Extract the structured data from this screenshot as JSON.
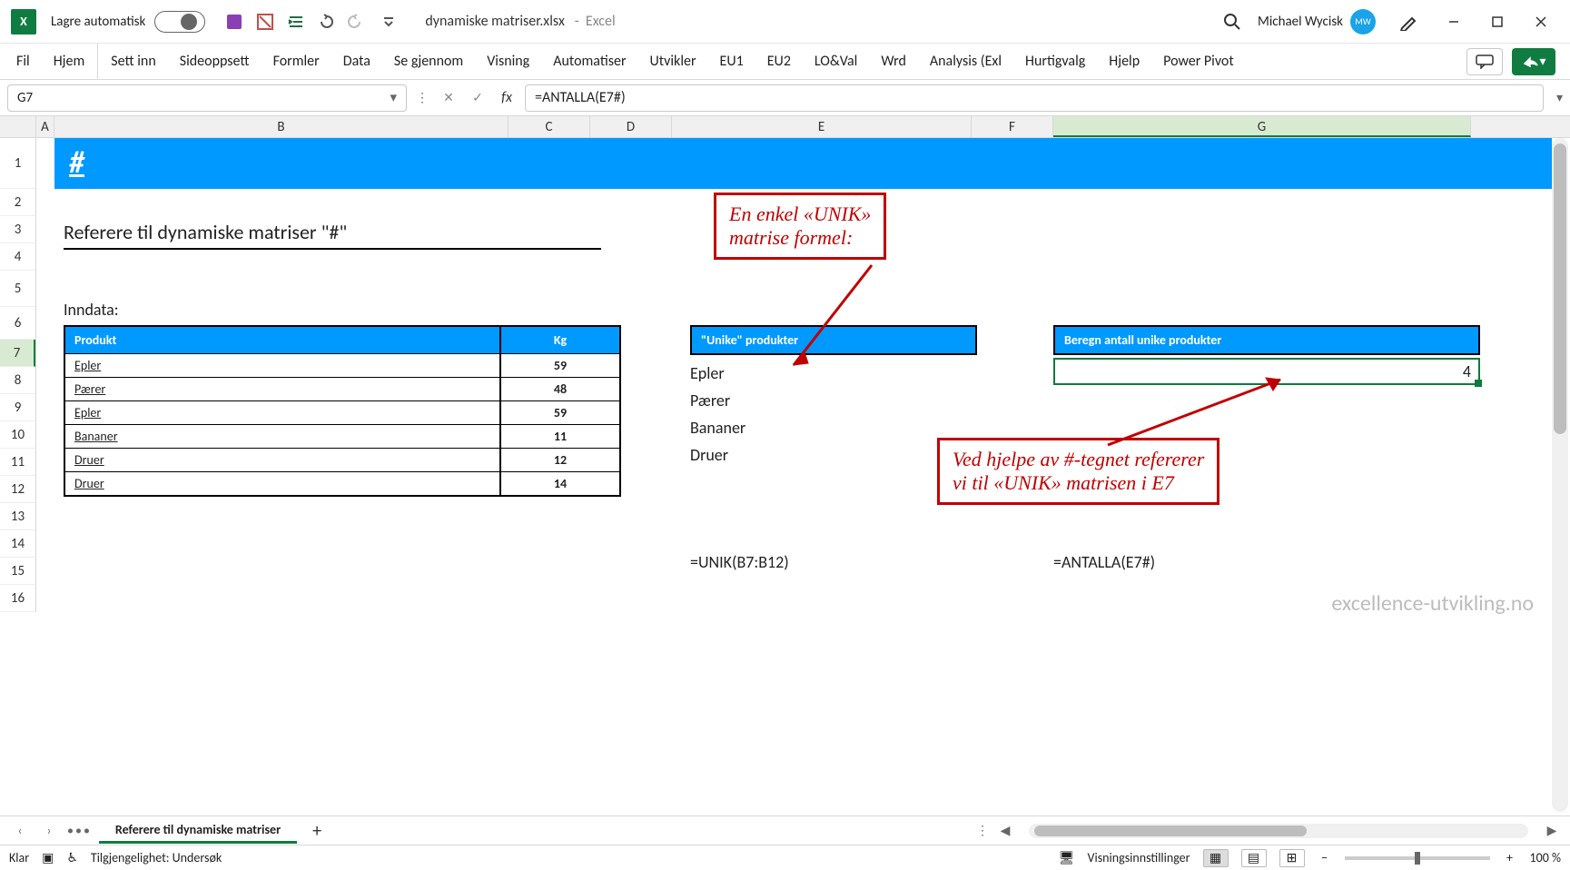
{
  "titlebar": {
    "autosave_label": "Lagre automatisk",
    "filename": "dynamiske matriser.xlsx",
    "appname": "Excel",
    "username": "Michael Wycisk"
  },
  "ribbon": {
    "tabs": [
      "Fil",
      "Hjem",
      "Sett inn",
      "Sideoppsett",
      "Formler",
      "Data",
      "Se gjennom",
      "Visning",
      "Automatiser",
      "Utvikler",
      "EU1",
      "EU2",
      "LO&Val",
      "Wrd",
      "Analysis (Exl",
      "Hurtigvalg",
      "Hjelp",
      "Power Pivot"
    ]
  },
  "formulabar": {
    "namebox": "G7",
    "formula": "=ANTALLA(E7#)"
  },
  "columns": [
    "A",
    "B",
    "C",
    "D",
    "E",
    "F",
    "G"
  ],
  "rows": [
    "1",
    "2",
    "3",
    "4",
    "5",
    "6",
    "7",
    "8",
    "9",
    "10",
    "11",
    "12",
    "13",
    "14",
    "15",
    "16"
  ],
  "sheet": {
    "banner": "#",
    "section_title": "Referere til dynamiske matriser \"#\"",
    "inndata_label": "Inndata:",
    "table1": {
      "h1": "Produkt",
      "h2": "Kg",
      "rows": [
        {
          "p": "Epler",
          "k": "59"
        },
        {
          "p": "Pærer",
          "k": "48"
        },
        {
          "p": "Epler",
          "k": "59"
        },
        {
          "p": "Bananer",
          "k": "11"
        },
        {
          "p": "Druer",
          "k": "12"
        },
        {
          "p": "Druer",
          "k": "14"
        }
      ]
    },
    "table2": {
      "header": "\"Unike\" produkter",
      "items": [
        "Epler",
        "Pærer",
        "Bananer",
        "Druer"
      ]
    },
    "table3": {
      "header": "Beregn antall unike produkter",
      "value": "4"
    },
    "formula_e": "=UNIK(B7:B12)",
    "formula_g": "=ANTALLA(E7#)",
    "annot1_l1": "En enkel «UNIK»",
    "annot1_l2": "matrise formel:",
    "annot2_l1": "Ved hjelpe av #-tegnet refererer",
    "annot2_l2": "vi til «UNIK» matrisen i E7",
    "watermark": "excellence-utvikling.no"
  },
  "sheettabs": {
    "active": "Referere til dynamiske matriser"
  },
  "statusbar": {
    "ready": "Klar",
    "access": "Tilgjengelighet: Undersøk",
    "display": "Visningsinnstillinger",
    "zoom": "100 %"
  }
}
